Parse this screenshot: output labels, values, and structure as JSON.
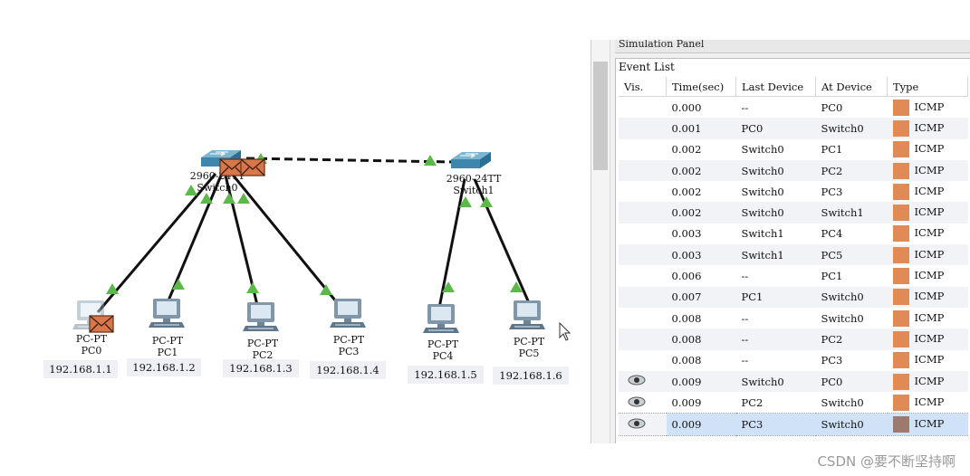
{
  "simulation_panel": {
    "title": "Simulation Panel",
    "event_list_title": "Event List",
    "columns": [
      "Vis.",
      "Time(sec)",
      "Last Device",
      "At Device",
      "Type"
    ],
    "events": [
      {
        "vis": false,
        "time": "0.000",
        "last": "--",
        "at": "PC0",
        "type": "ICMP",
        "color": "#e08a55"
      },
      {
        "vis": false,
        "time": "0.001",
        "last": "PC0",
        "at": "Switch0",
        "type": "ICMP",
        "color": "#e08a55"
      },
      {
        "vis": false,
        "time": "0.002",
        "last": "Switch0",
        "at": "PC1",
        "type": "ICMP",
        "color": "#e08a55"
      },
      {
        "vis": false,
        "time": "0.002",
        "last": "Switch0",
        "at": "PC2",
        "type": "ICMP",
        "color": "#e08a55"
      },
      {
        "vis": false,
        "time": "0.002",
        "last": "Switch0",
        "at": "PC3",
        "type": "ICMP",
        "color": "#e08a55"
      },
      {
        "vis": false,
        "time": "0.002",
        "last": "Switch0",
        "at": "Switch1",
        "type": "ICMP",
        "color": "#e08a55"
      },
      {
        "vis": false,
        "time": "0.003",
        "last": "Switch1",
        "at": "PC4",
        "type": "ICMP",
        "color": "#e08a55"
      },
      {
        "vis": false,
        "time": "0.003",
        "last": "Switch1",
        "at": "PC5",
        "type": "ICMP",
        "color": "#e08a55"
      },
      {
        "vis": false,
        "time": "0.006",
        "last": "--",
        "at": "PC1",
        "type": "ICMP",
        "color": "#e08a55"
      },
      {
        "vis": false,
        "time": "0.007",
        "last": "PC1",
        "at": "Switch0",
        "type": "ICMP",
        "color": "#e08a55"
      },
      {
        "vis": false,
        "time": "0.008",
        "last": "--",
        "at": "Switch0",
        "type": "ICMP",
        "color": "#e08a55"
      },
      {
        "vis": false,
        "time": "0.008",
        "last": "--",
        "at": "PC2",
        "type": "ICMP",
        "color": "#e08a55"
      },
      {
        "vis": false,
        "time": "0.008",
        "last": "--",
        "at": "PC3",
        "type": "ICMP",
        "color": "#e08a55"
      },
      {
        "vis": true,
        "time": "0.009",
        "last": "Switch0",
        "at": "PC0",
        "type": "ICMP",
        "color": "#e08a55"
      },
      {
        "vis": true,
        "time": "0.009",
        "last": "PC2",
        "at": "Switch0",
        "type": "ICMP",
        "color": "#e08a55"
      },
      {
        "vis": true,
        "time": "0.009",
        "last": "PC3",
        "at": "Switch0",
        "type": "ICMP",
        "color": "#9e7a6e",
        "selected": true
      }
    ]
  },
  "topology": {
    "switches": [
      {
        "id": "switch0",
        "model": "2960-24TT",
        "name": "Switch0"
      },
      {
        "id": "switch1",
        "model": "2960-24TT",
        "name": "Switch1"
      }
    ],
    "pcs": [
      {
        "id": "pc0",
        "model": "PC-PT",
        "name": "PC0",
        "ip": "192.168.1.1"
      },
      {
        "id": "pc1",
        "model": "PC-PT",
        "name": "PC1",
        "ip": "192.168.1.2"
      },
      {
        "id": "pc2",
        "model": "PC-PT",
        "name": "PC2",
        "ip": "192.168.1.3"
      },
      {
        "id": "pc3",
        "model": "PC-PT",
        "name": "PC3",
        "ip": "192.168.1.4"
      },
      {
        "id": "pc4",
        "model": "PC-PT",
        "name": "PC4",
        "ip": "192.168.1.5"
      },
      {
        "id": "pc5",
        "model": "PC-PT",
        "name": "PC5",
        "ip": "192.168.1.6"
      }
    ],
    "link_status_color": "#5cb84a",
    "envelope_color": "#d9774a"
  },
  "watermark": "CSDN @要不断坚持啊"
}
